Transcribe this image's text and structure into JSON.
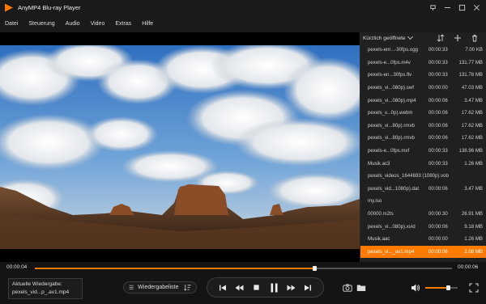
{
  "app": {
    "title": "AnyMP4 Blu-ray Player"
  },
  "menu": [
    "Datei",
    "Steuerung",
    "Audio",
    "Video",
    "Extras",
    "Hilfe"
  ],
  "playlist": {
    "header": "Kürzlich geöffnete",
    "items": [
      {
        "name": "pexels-enr...-30fps.ogg",
        "duration": "00:00:33",
        "size": "7.00 KB"
      },
      {
        "name": "pexels-e...0fps.m4v",
        "duration": "00:00:33",
        "size": "131.77 MB"
      },
      {
        "name": "pexels-en...30fps.flv",
        "duration": "00:00:33",
        "size": "131.78 MB"
      },
      {
        "name": "pexels_vi...080p).swf",
        "duration": "00:00:00",
        "size": "47.03 MB"
      },
      {
        "name": "pexels_vi...080p).mp4",
        "duration": "00:00:06",
        "size": "3.47 MB"
      },
      {
        "name": "pexels_v...0p).webm",
        "duration": "00:00:06",
        "size": "17.62 MB"
      },
      {
        "name": "pexels_vi...80p).rmvb",
        "duration": "00:00:06",
        "size": "17.62 MB"
      },
      {
        "name": "pexels_vi...80p).rmvb",
        "duration": "00:00:06",
        "size": "17.62 MB"
      },
      {
        "name": "pexels-e...0fps.mxf",
        "duration": "00:00:33",
        "size": "138.96 MB"
      },
      {
        "name": "Musik.ac3",
        "duration": "00:00:33",
        "size": "1.26 MB"
      },
      {
        "name": "pexels_videos_1644693 (1080p).vob",
        "duration": "",
        "size": ""
      },
      {
        "name": "pexels_vid...1080p).dat",
        "duration": "00:00:06",
        "size": "3.47 MB"
      },
      {
        "name": "my.iso",
        "duration": "",
        "size": ""
      },
      {
        "name": "00000.m2ts",
        "duration": "00:00:30",
        "size": "26.91 MB"
      },
      {
        "name": "pexels_vi...080p).xvid",
        "duration": "00:00:06",
        "size": "9.18 MB"
      },
      {
        "name": "Musik.aac",
        "duration": "00:00:00",
        "size": "1.26 MB"
      },
      {
        "name": "pexels_vi..._av1.mp4",
        "duration": "00:00:06",
        "size": "2.08 MB"
      }
    ],
    "active_index": 16
  },
  "player": {
    "current_time": "00:00:04",
    "total_time": "00:00:06",
    "progress": 0.67,
    "volume": 0.7,
    "now_playing_label": "Aktuelle Wiedergabe:",
    "now_playing_title": "pexels_vid...p_.av1.mp4",
    "playlist_button_label": "Wiedergabeliste"
  },
  "colors": {
    "accent": "#ff7a00",
    "background": "#141414",
    "panel": "#202020"
  },
  "icons": {
    "window": [
      "pin-icon",
      "minimize-icon",
      "maximize-icon",
      "close-icon"
    ],
    "playlist_tools": [
      "sort-icon",
      "add-icon",
      "delete-icon"
    ],
    "transport": [
      "skip-back-icon",
      "rewind-icon",
      "stop-icon",
      "pause-icon",
      "fast-forward-icon",
      "skip-forward-icon"
    ]
  }
}
